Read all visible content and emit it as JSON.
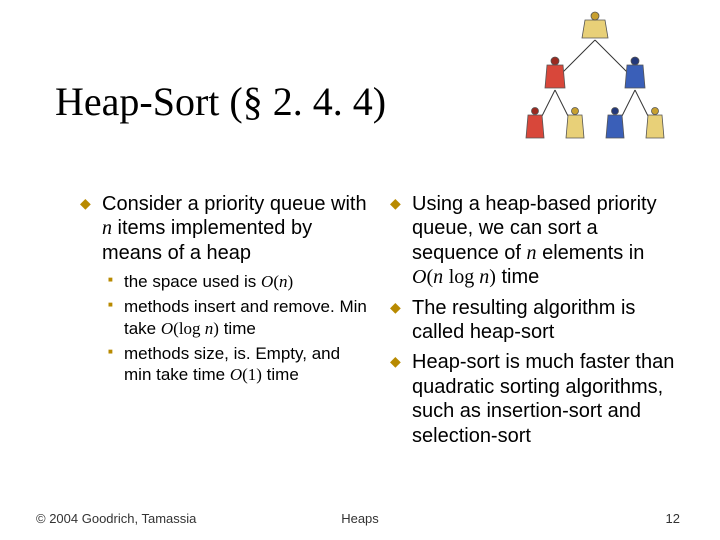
{
  "title": "Heap-Sort (§ 2. 4. 4)",
  "left": {
    "b1_pre": "Consider a priority queue with ",
    "b1_n": "n",
    "b1_post": " items implemented by means of a heap",
    "s1_pre": "the space used is ",
    "s1_bigO": "O",
    "s1_paren_open": "(",
    "s1_n": "n",
    "s1_paren_close": ")",
    "s2_pre": "methods insert and remove. Min take ",
    "s2_bigO": "O",
    "s2_paren_open": "(",
    "s2_log": "log ",
    "s2_n": "n",
    "s2_paren_close": ")",
    "s2_post": " time",
    "s3_pre": "methods size, is. Empty, and min take time ",
    "s3_bigO": "O",
    "s3_paren_open": "(",
    "s3_one": "1",
    "s3_paren_close": ")",
    "s3_post": " time"
  },
  "right": {
    "b1_pre": "Using a heap-based priority queue, we can sort a sequence of ",
    "b1_n1": "n",
    "b1_mid": " elements in ",
    "b1_bigO": "O",
    "b1_paren_open": "(",
    "b1_n2": "n",
    "b1_sp": " ",
    "b1_log": "log ",
    "b1_n3": "n",
    "b1_paren_close": ")",
    "b1_post": " time",
    "b2": "The resulting algorithm is called heap-sort",
    "b3": "Heap-sort is much faster than quadratic sorting algorithms, such as insertion-sort and selection-sort"
  },
  "footer": {
    "left": "© 2004 Goodrich, Tamassia",
    "center": "Heaps",
    "right": "12"
  }
}
